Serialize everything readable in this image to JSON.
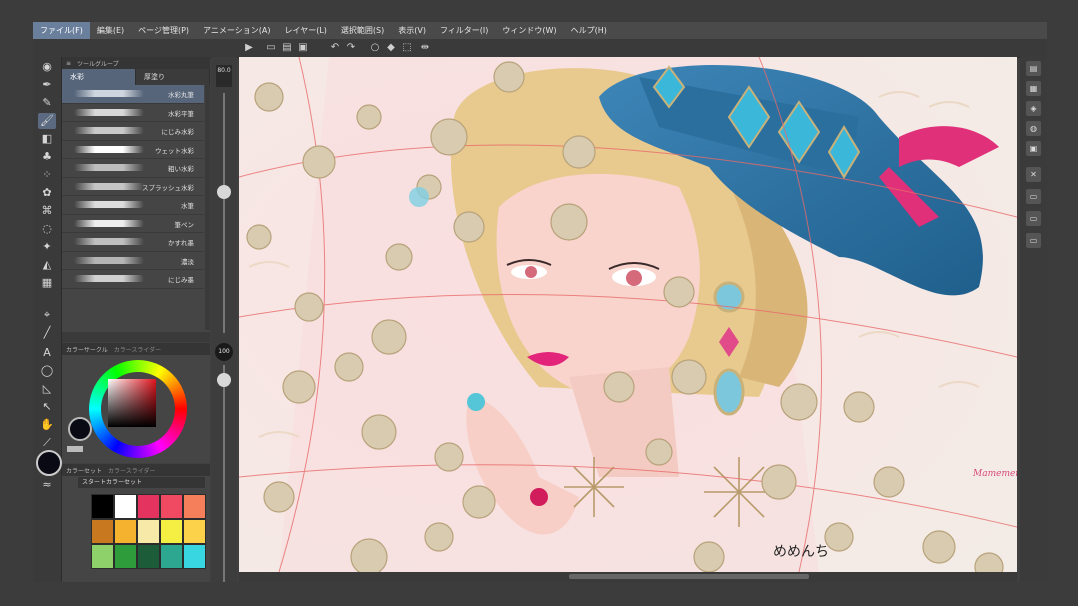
{
  "menu": [
    {
      "label": "ファイル(F)",
      "active": true
    },
    {
      "label": "編集(E)"
    },
    {
      "label": "ページ管理(P)"
    },
    {
      "label": "アニメーション(A)"
    },
    {
      "label": "レイヤー(L)"
    },
    {
      "label": "選択範囲(S)"
    },
    {
      "label": "表示(V)"
    },
    {
      "label": "フィルター(I)"
    },
    {
      "label": "ウィンドウ(W)"
    },
    {
      "label": "ヘルプ(H)"
    }
  ],
  "subtool": {
    "header": "ツールグループ",
    "tabs": [
      "水彩",
      "厚塗り"
    ],
    "brushes": [
      {
        "name": "水彩丸筆",
        "selected": true
      },
      {
        "name": "水彩平筆"
      },
      {
        "name": "にじみ水彩"
      },
      {
        "name": "ウェット水彩"
      },
      {
        "name": "粗い水彩"
      },
      {
        "name": "スプラッシュ水彩"
      },
      {
        "name": "水筆"
      },
      {
        "name": "筆ペン"
      },
      {
        "name": "かすれ墨"
      },
      {
        "name": "濃淡"
      },
      {
        "name": "にじみ墨"
      }
    ]
  },
  "color_wheel": {
    "tabs": [
      "カラーサークル",
      "カラースライダー"
    ],
    "hue_color": "#e0141e",
    "foreground": "#0a0a14"
  },
  "color_set": {
    "tabs": [
      "カラーセット",
      "カラースライダー"
    ],
    "selected_set": "スタートカラーセット",
    "swatches": [
      "#000000",
      "#ffffff",
      "#e4335f",
      "#f04a63",
      "#f57f5a",
      "#c8791f",
      "#f5b22f",
      "#f7e9a8",
      "#f4ef42",
      "#fbd24a",
      "#8ed16a",
      "#2e9c3a",
      "#1d5c38",
      "#2da78f",
      "#38d6e0"
    ]
  },
  "brush_size": "80.0",
  "opacity": "100",
  "canvas": {
    "signature": "Mamemenchi",
    "credit": "めめんち"
  },
  "right_panel_icons": [
    "navigator-icon",
    "layer-property-icon",
    "layer-icon",
    "material-icon",
    "history-icon",
    "close-panel-icon",
    "panel-a-icon",
    "panel-b-icon",
    "panel-c-icon"
  ]
}
